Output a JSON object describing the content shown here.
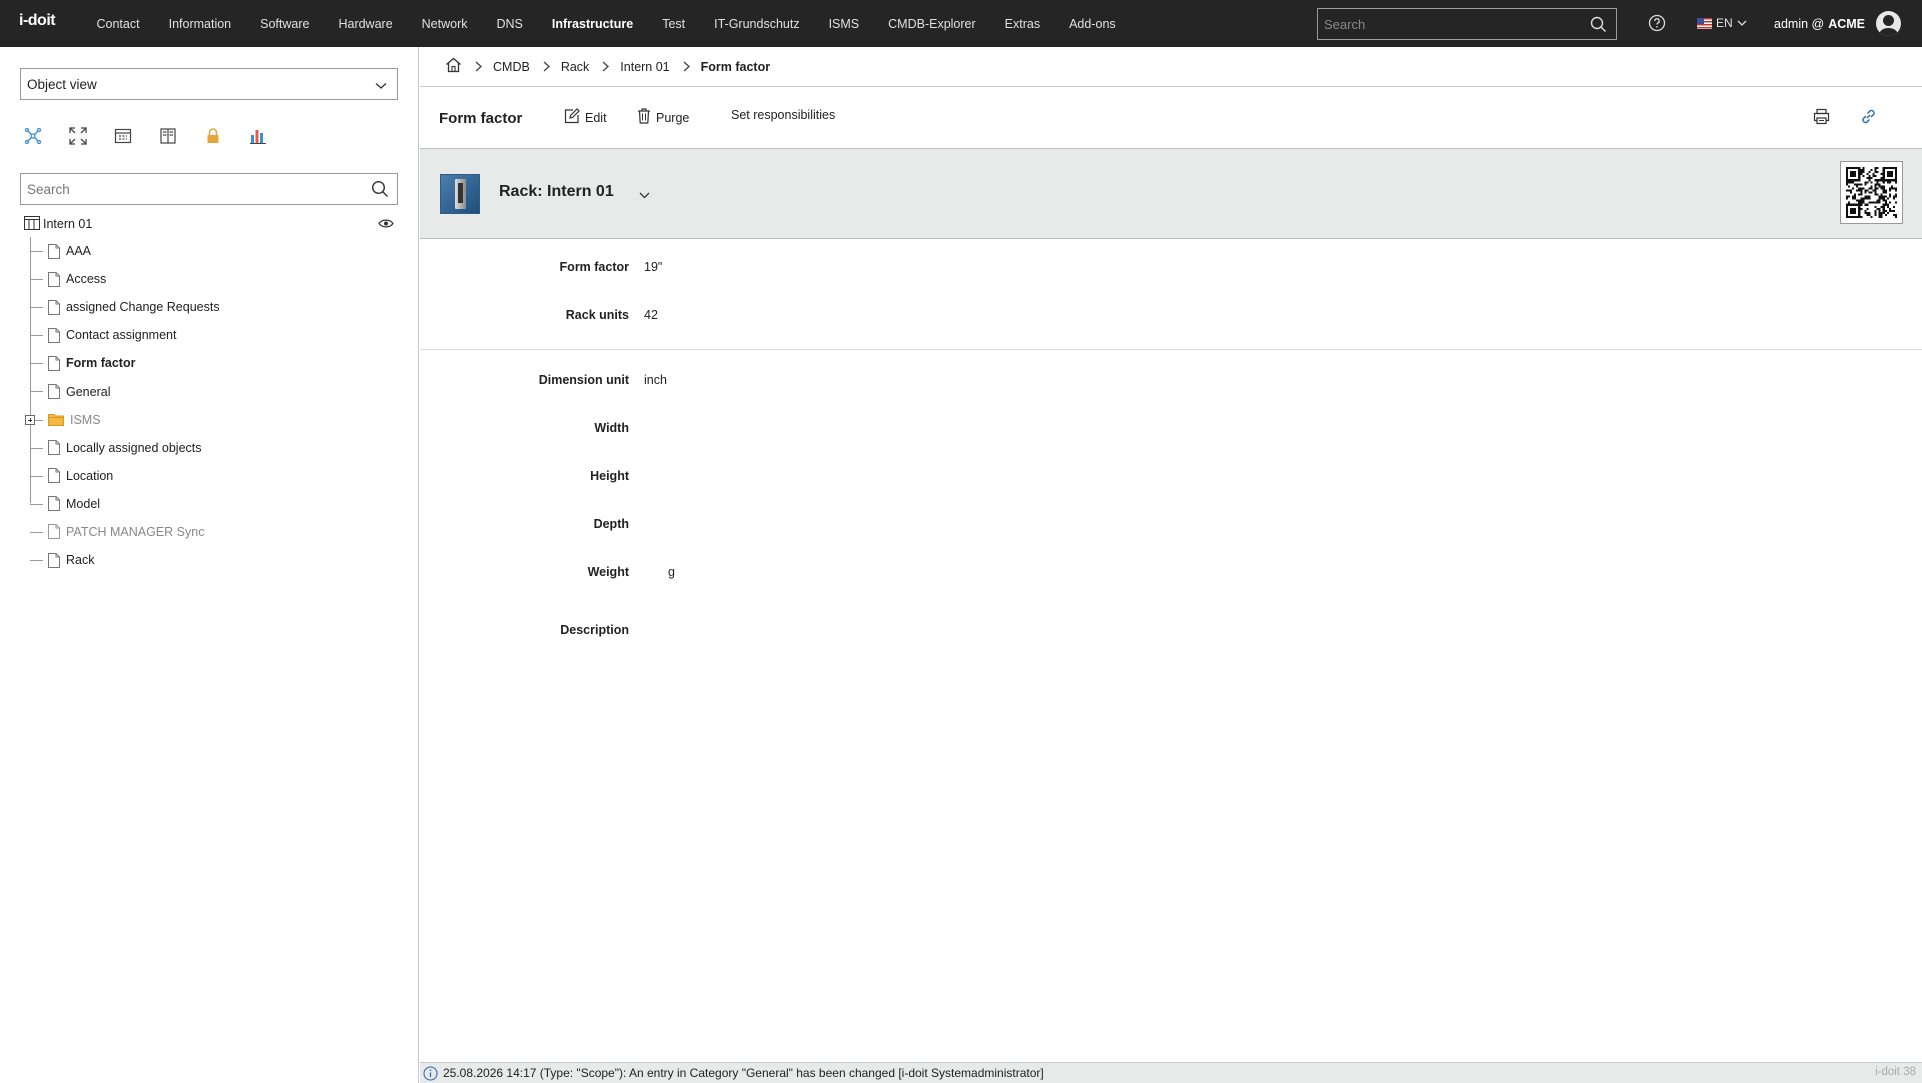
{
  "topbar": {
    "logo": "i-doit",
    "nav": [
      "Contact",
      "Information",
      "Software",
      "Hardware",
      "Network",
      "DNS",
      "Infrastructure",
      "Test",
      "IT-Grundschutz",
      "ISMS",
      "CMDB-Explorer",
      "Extras",
      "Add-ons"
    ],
    "active_nav": "Infrastructure",
    "search_placeholder": "Search",
    "language": "EN",
    "user": "admin @",
    "tenant": "ACME"
  },
  "sidebar": {
    "view_select": "Object view",
    "search_placeholder": "Search",
    "tree_root": "Intern 01",
    "tree_items": [
      {
        "label": "AAA",
        "style": "normal"
      },
      {
        "label": "Access",
        "style": "normal"
      },
      {
        "label": "assigned Change Requests",
        "style": "normal"
      },
      {
        "label": "Contact assignment",
        "style": "normal"
      },
      {
        "label": "Form factor",
        "style": "bold"
      },
      {
        "label": "General",
        "style": "normal"
      },
      {
        "label": "ISMS",
        "style": "folder"
      },
      {
        "label": "Locally assigned objects",
        "style": "normal"
      },
      {
        "label": "Location",
        "style": "normal"
      },
      {
        "label": "Model",
        "style": "normal"
      },
      {
        "label": "PATCH MANAGER Sync",
        "style": "muted"
      },
      {
        "label": "Rack",
        "style": "normal"
      }
    ]
  },
  "breadcrumb": {
    "items": [
      "CMDB",
      "Rack",
      "Intern 01",
      "Form factor"
    ]
  },
  "toolbar": {
    "title": "Form factor",
    "edit": "Edit",
    "purge": "Purge",
    "responsibilities": "Set responsibilities"
  },
  "object": {
    "title": "Rack: Intern 01"
  },
  "fields": {
    "form_factor": {
      "label": "Form factor",
      "value": "19\""
    },
    "rack_units": {
      "label": "Rack units",
      "value": "42"
    },
    "dimension_unit": {
      "label": "Dimension unit",
      "value": "inch"
    },
    "width": {
      "label": "Width",
      "value": ""
    },
    "height": {
      "label": "Height",
      "value": ""
    },
    "depth": {
      "label": "Depth",
      "value": ""
    },
    "weight": {
      "label": "Weight",
      "value": "g"
    },
    "description": {
      "label": "Description",
      "value": ""
    }
  },
  "status": {
    "message": "25.08.2026 14:17 (Type: \"Scope\"): An entry in Category \"General\" has been changed [i-doit Systemadministrator]",
    "version": "i-doit 38"
  },
  "colors": {
    "topbar": "#252525",
    "header_band": "#e8e9e9",
    "folder": "#f5b942",
    "lock_icon": "#e8a53a"
  }
}
